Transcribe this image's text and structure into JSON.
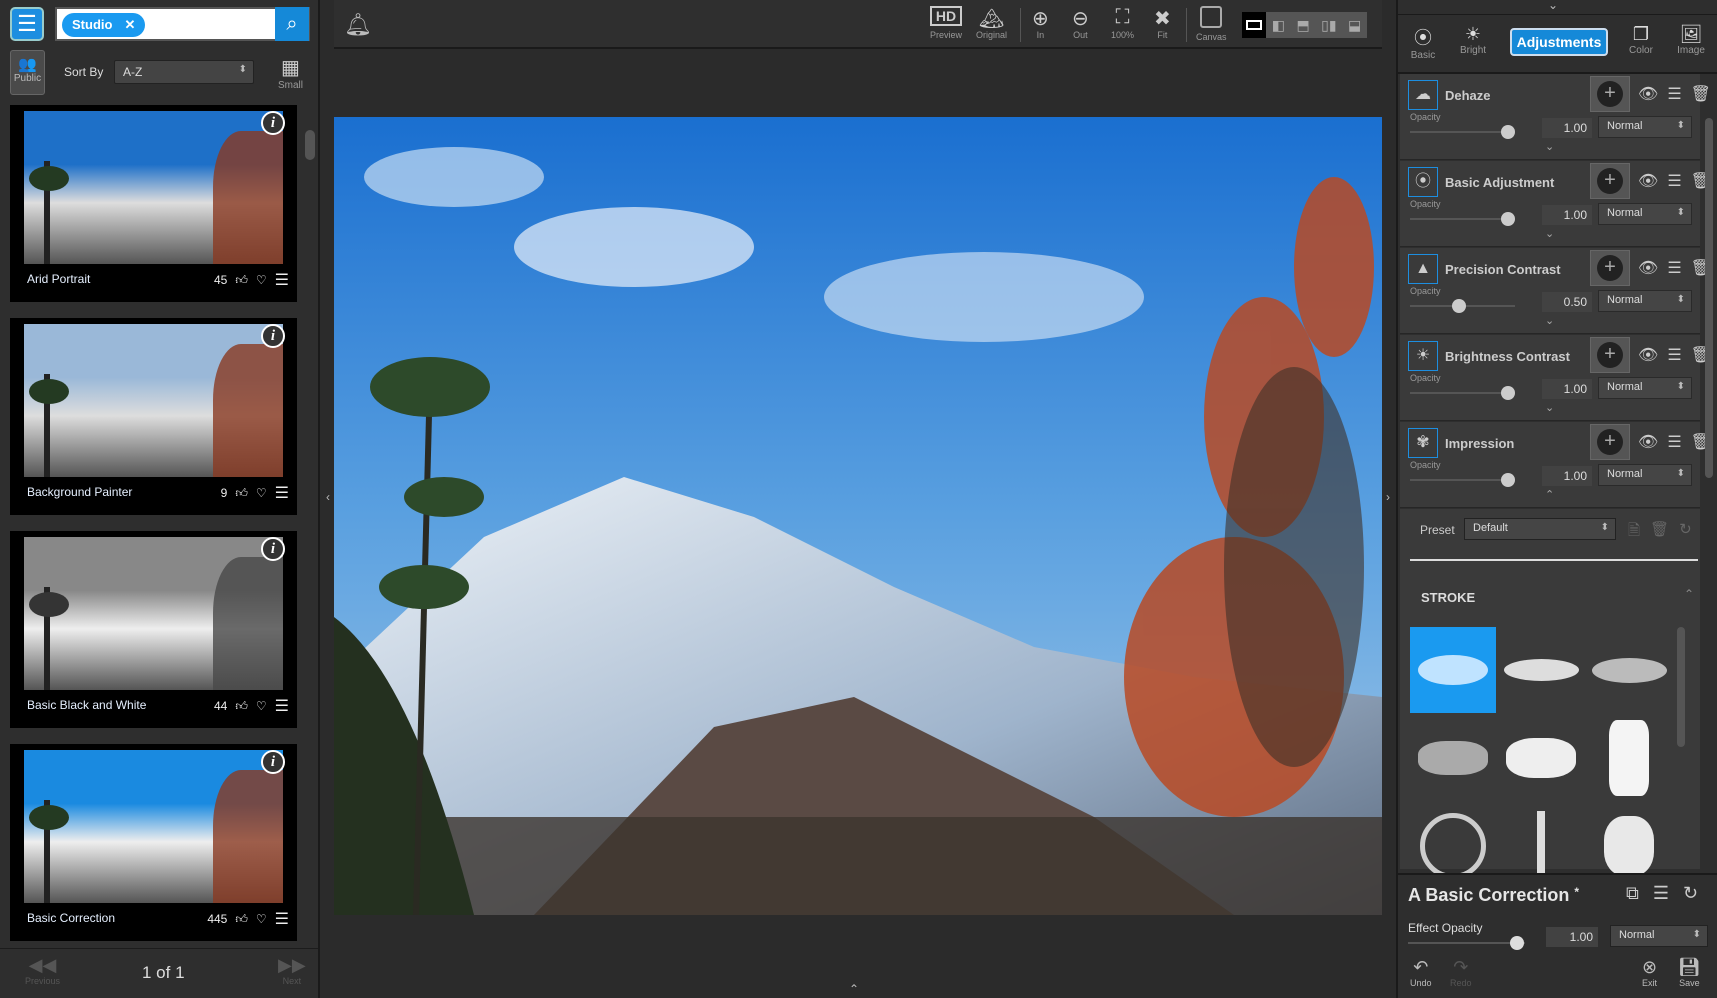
{
  "left_panel": {
    "search_chip": "Studio",
    "public_label": "Public",
    "sort_label": "Sort By",
    "sort_value": "A-Z",
    "view_label": "Small",
    "presets": [
      {
        "name": "Arid Portrait",
        "likes": "45"
      },
      {
        "name": "Background Painter",
        "likes": "9"
      },
      {
        "name": "Basic Black and White",
        "likes": "44"
      },
      {
        "name": "Basic Correction",
        "likes": "445"
      }
    ],
    "pager": {
      "prev": "Previous",
      "page": "1 of 1",
      "next": "Next"
    }
  },
  "toolbar": {
    "preview": "Preview",
    "original": "Original",
    "zoom_in": "In",
    "zoom_out": "Out",
    "zoom_100": "100%",
    "fit": "Fit",
    "canvas": "Canvas"
  },
  "right_panel": {
    "tabs": [
      "Basic",
      "Bright",
      "Adjustments",
      "Color",
      "Image"
    ],
    "active_tab": "Adjustments",
    "layers": [
      {
        "name": "Dehaze",
        "opacity_label": "Opacity",
        "opacity": "1.00",
        "blend": "Normal",
        "level": 1.0
      },
      {
        "name": "Basic Adjustment",
        "opacity_label": "Opacity",
        "opacity": "1.00",
        "blend": "Normal",
        "level": 1.0
      },
      {
        "name": "Precision Contrast",
        "opacity_label": "Opacity",
        "opacity": "0.50",
        "blend": "Normal",
        "level": 0.5
      },
      {
        "name": "Brightness Contrast",
        "opacity_label": "Opacity",
        "opacity": "1.00",
        "blend": "Normal",
        "level": 1.0
      },
      {
        "name": "Impression",
        "opacity_label": "Opacity",
        "opacity": "1.00",
        "blend": "Normal",
        "level": 1.0
      }
    ],
    "preset_label": "Preset",
    "preset_value": "Default",
    "stroke_title": "STROKE",
    "effect": {
      "title": "A Basic Correction",
      "modified": "*",
      "opacity_label": "Effect Opacity",
      "opacity": "1.00",
      "blend": "Normal",
      "undo": "Undo",
      "redo": "Redo",
      "exit": "Exit",
      "save": "Save"
    }
  },
  "colors": {
    "accent": "#1589d8"
  }
}
